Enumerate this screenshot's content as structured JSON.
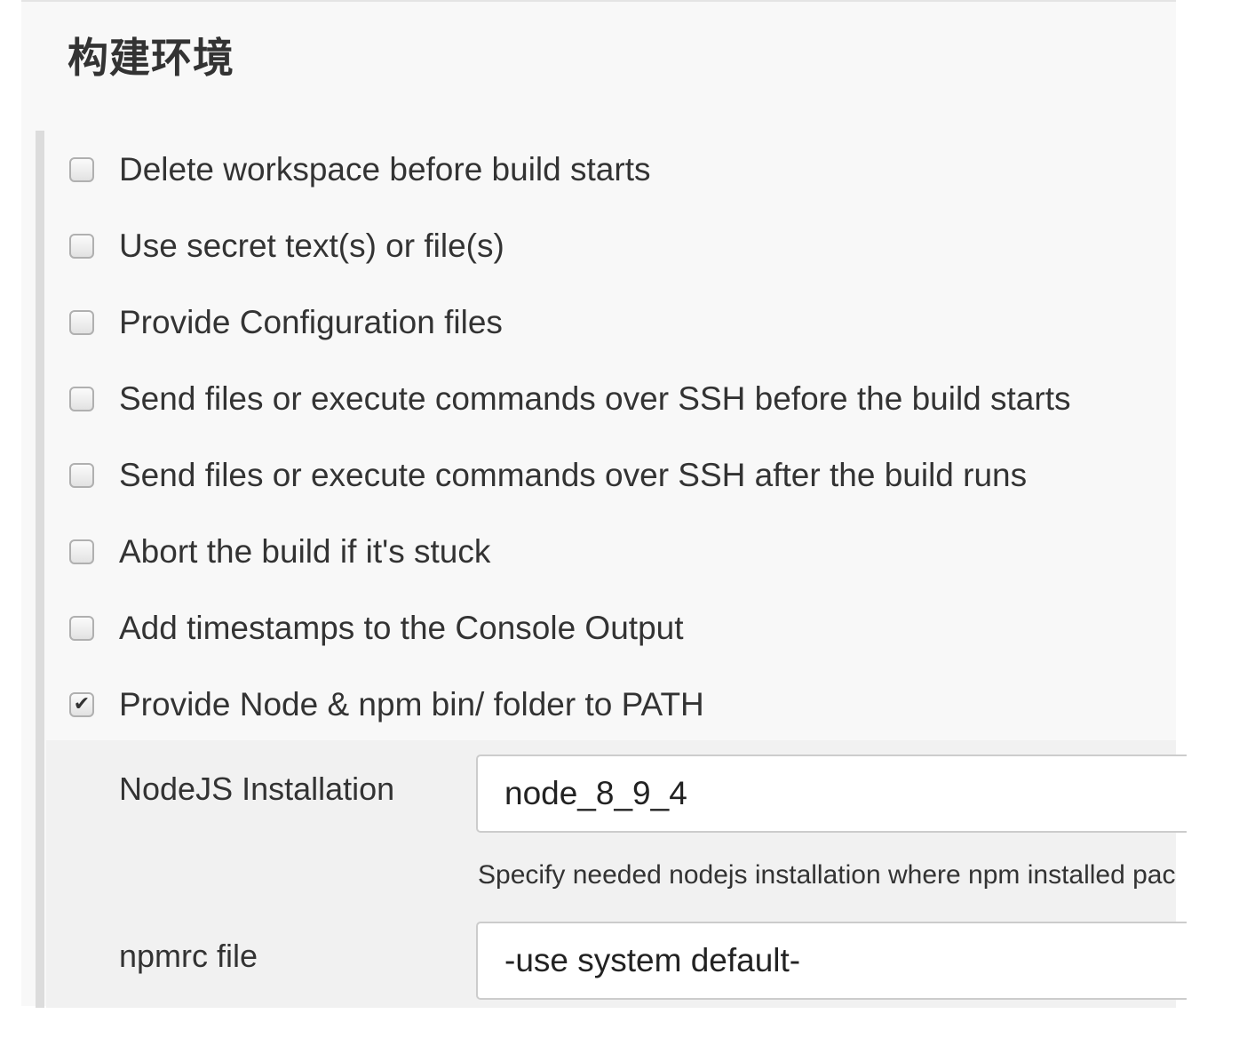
{
  "section": {
    "title": "构建环境"
  },
  "options": [
    {
      "label": "Delete workspace before build starts",
      "checked": false
    },
    {
      "label": "Use secret text(s) or file(s)",
      "checked": false
    },
    {
      "label": "Provide Configuration files",
      "checked": false
    },
    {
      "label": "Send files or execute commands over SSH before the build starts",
      "checked": false
    },
    {
      "label": "Send files or execute commands over SSH after the build runs",
      "checked": false
    },
    {
      "label": "Abort the build if it's stuck",
      "checked": false
    },
    {
      "label": "Add timestamps to the Console Output",
      "checked": false
    },
    {
      "label": "Provide Node & npm bin/ folder to PATH",
      "checked": true,
      "check_glyph": "✔"
    }
  ],
  "node_config": {
    "nodejs_installation": {
      "label": "NodeJS Installation",
      "value": "node_8_9_4",
      "help": "Specify needed nodejs installation where npm installed packages will be provided to the PATH"
    },
    "npmrc_file": {
      "label": "npmrc file",
      "value": "-use system default-"
    }
  },
  "icons": {
    "checkbox": "checkbox-icon",
    "check": "checkmark-icon"
  },
  "colors": {
    "panel_background": "#f8f8f8",
    "sub_panel_background": "#f1f1f1",
    "text": "#333333",
    "input_border": "#cccccc"
  }
}
